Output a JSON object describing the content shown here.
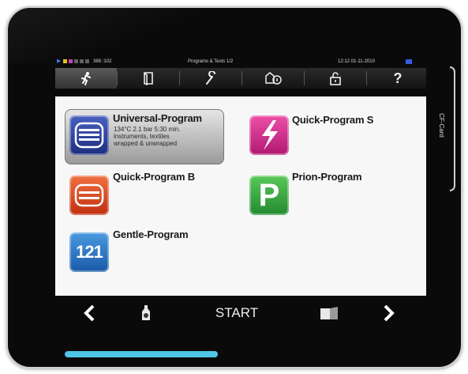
{
  "status_bar": {
    "counter": "389 :102",
    "title": "Programs & Tests 1/2",
    "datetime": "12:12  01-11-2010"
  },
  "tabs": [
    {
      "icon": "runner-icon",
      "selected": true
    },
    {
      "icon": "document-icon",
      "selected": false
    },
    {
      "icon": "wrench-icon",
      "selected": false
    },
    {
      "icon": "cycle-info-icon",
      "selected": false
    },
    {
      "icon": "lock-icon",
      "selected": false
    },
    {
      "icon": "help-icon",
      "selected": false
    }
  ],
  "programs": {
    "universal": {
      "name": "Universal-Program",
      "detail_1": "134°C 2.1 bar 5:30 min.",
      "detail_2": "instruments, textiles",
      "detail_3": "wrapped & unwrapped",
      "color": "#2a3f9a"
    },
    "quick_s": {
      "name": "Quick-Program S",
      "color": "#d6308c"
    },
    "quick_b": {
      "name": "Quick-Program B",
      "color": "#e0502a"
    },
    "prion": {
      "name": "Prion-Program",
      "icon_text": "P",
      "color": "#3aa84a"
    },
    "gentle": {
      "name": "Gentle-Program",
      "icon_text": "121",
      "color": "#2a7ac8"
    }
  },
  "bottom": {
    "start_label": "START"
  },
  "side": {
    "card_label": "CF-Card"
  },
  "colors": {
    "accent_bar": "#4fc6e6"
  }
}
